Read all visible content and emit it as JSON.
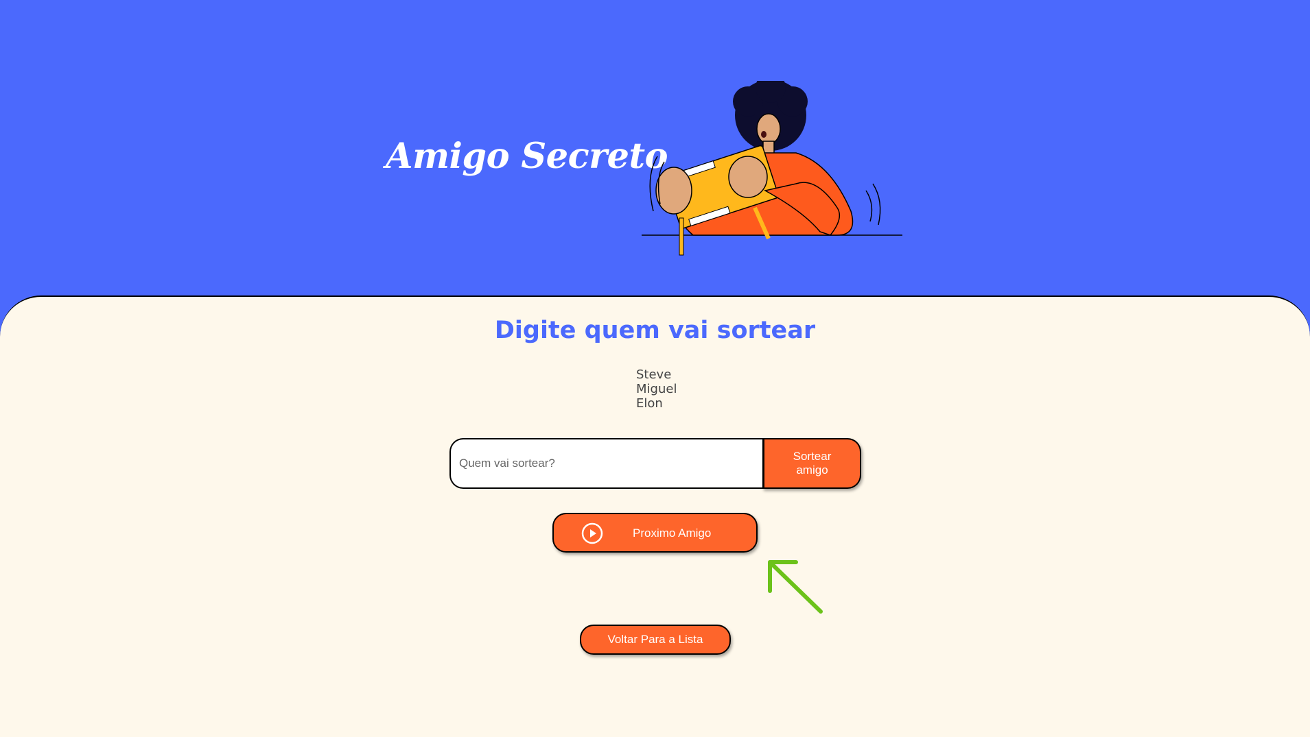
{
  "header": {
    "title": "Amigo Secreto"
  },
  "main": {
    "heading": "Digite quem vai sortear",
    "friends": [
      "Steve",
      "Miguel",
      "Elon"
    ],
    "input": {
      "placeholder": "Quem vai sortear?",
      "value": ""
    },
    "draw_button_label": "Sortear amigo",
    "next_button_label": "Proximo Amigo",
    "back_button_label": "Voltar Para a Lista"
  },
  "colors": {
    "header_background": "#4b69fd",
    "page_background": "#fef8eb",
    "accent": "#fe652b",
    "heading": "#4b69fd",
    "annotation_arrow": "#6cc21a"
  },
  "icons": {
    "next_button_icon": "play-circle-icon",
    "annotation": "arrow-up-left-icon"
  }
}
